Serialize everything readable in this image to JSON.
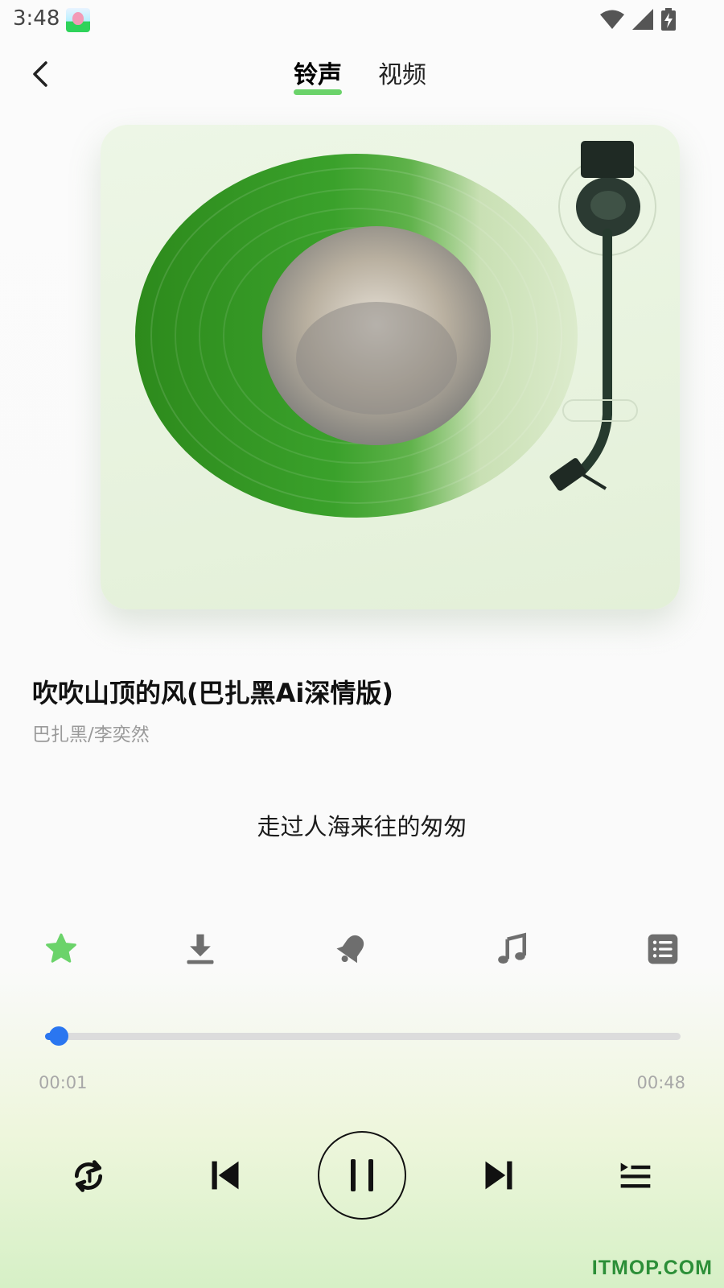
{
  "status_bar": {
    "time": "3:48",
    "icons": [
      "app-icon",
      "wifi-icon",
      "signal-icon",
      "battery-charging-icon"
    ]
  },
  "header": {
    "tabs": [
      {
        "label": "铃声",
        "active": true
      },
      {
        "label": "视频",
        "active": false
      }
    ],
    "accent_color": "#6bd36a"
  },
  "player": {
    "vinyl_color": "#3b9b24",
    "song_title": "吹吹山顶的风(巴扎黑Ai深情版)",
    "artist": "巴扎黑/李奕然",
    "current_lyric": "走过人海来往的匆匆"
  },
  "actions": [
    {
      "name": "favorite",
      "icon": "star-icon",
      "active": true
    },
    {
      "name": "download",
      "icon": "download-icon"
    },
    {
      "name": "set-ringtone",
      "icon": "bell-icon"
    },
    {
      "name": "music",
      "icon": "music-note-icon"
    },
    {
      "name": "list",
      "icon": "list-icon"
    }
  ],
  "progress": {
    "current_time": "00:01",
    "total_time": "00:48",
    "fraction": 0.021,
    "color": "#2a76f0"
  },
  "controls": [
    "repeat-icon",
    "previous-icon",
    "pause-icon",
    "next-icon",
    "playlist-icon"
  ],
  "watermark": "ITMOP.COM"
}
